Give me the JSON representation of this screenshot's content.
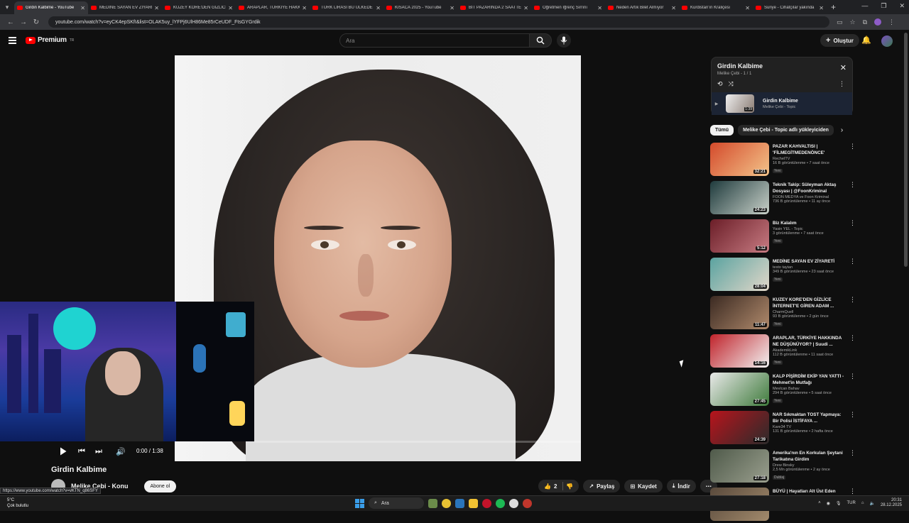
{
  "browser": {
    "tabs": [
      {
        "title": "Girdin Kalbime - YouTube",
        "active": true
      },
      {
        "title": "MEDİNE SAYAN EV ZİYARETİ",
        "active": false
      },
      {
        "title": "KUZEY KORE'DEN GİZLİCE",
        "active": false
      },
      {
        "title": "ARAPLAR, TÜRKİYE HAKKINDA",
        "active": false
      },
      {
        "title": "TÜRK LİRASI BU ÜLKEDE",
        "active": false
      },
      {
        "title": "KISACA 2025 - YouTube",
        "active": false
      },
      {
        "title": "BİT PAZARINDA 2 SAATTE",
        "active": false
      },
      {
        "title": "Öğretmen İğrenç Sırrını",
        "active": false
      },
      {
        "title": "Neden Artık Bilet Almıyor",
        "active": false
      },
      {
        "title": "Kürdistan'ın Kraliçesi",
        "active": false
      },
      {
        "title": "Suriye - Cihatçılar yakında",
        "active": false
      }
    ],
    "url": "youtube.com/watch?v=eyCK4epSKfI&list=OLAK5uy_lYFPj6UlH86Me85rCeUDF_FtsGYGrdik",
    "status_url": "https://www.youtube.com/watch?v=vKTN_q86SFY"
  },
  "youtube": {
    "logo_text": "Premium",
    "logo_region": "TR",
    "search_placeholder": "Ara",
    "create_label": "Oluştur"
  },
  "player": {
    "time": "0:00 / 1:38",
    "progress": 0.0
  },
  "video": {
    "title": "Girdin Kalbime",
    "channel": "Melike Çebi - Konu",
    "subscribe": "Abone ol",
    "likes": "2",
    "share": "Paylaş",
    "save": "Kaydet",
    "download": "İndir"
  },
  "playlist": {
    "title": "Girdin Kalbime",
    "subtitle": "Melike Çebi - 1 / 1",
    "item_title": "Girdin Kalbime",
    "item_channel": "Melike Çebi - Topic",
    "item_duration": "1:39"
  },
  "chips": [
    "Tümü",
    "Melike Çebi - Topic adlı yükleyiciden"
  ],
  "recommendations": [
    {
      "title": "PAZAR KAHVALTISI | 'FİLMEGİTMEDENÖNCE'",
      "channel": "RecheITV",
      "meta": "16 B görüntülenme • 7 saat önce",
      "badge": "Yeni",
      "duration": "32:21",
      "c1": "#d44a2b",
      "c2": "#f3c48a"
    },
    {
      "title": "Teknik Takip: Süleyman Aktaş Dosyası | @FoonKriminal",
      "channel": "FOON MEDYA ve Foon Kriminal",
      "meta": "736 B görüntülenme • 11 ay önce",
      "badge": "",
      "duration": "24:23",
      "c1": "#1f3b3d",
      "c2": "#c8d0c8"
    },
    {
      "title": "Biz Kalalım",
      "channel": "Yasin YEL - Topic",
      "meta": "3 görüntülenme • 7 saat önce",
      "badge": "Yeni",
      "duration": "5:12",
      "c1": "#6b1e28",
      "c2": "#c77b82"
    },
    {
      "title": "MEDİNE SAYAN EV ZİYARETİ",
      "channel": "testo tayian",
      "meta": "349 B görüntülenme • 23 saat önce",
      "badge": "Yeni",
      "duration": "28:04",
      "c1": "#5aa3a0",
      "c2": "#e2d7c9"
    },
    {
      "title": "KUZEY KORE'DEN GİZLİCE İNTERNET'E GİREN ADAM ...",
      "channel": "CharmQuell",
      "meta": "93 B görüntülenme • 2 gün önce",
      "badge": "Yeni",
      "duration": "11:47",
      "c1": "#3b2a22",
      "c2": "#b08a6c"
    },
    {
      "title": "ARAPLAR, TÜRKİYE HAKKINDA NE DÜŞÜNÜYOR? | Suudi ...",
      "channel": "AkademikLink",
      "meta": "112 B görüntülenme • 11 saat önce",
      "badge": "Yeni",
      "duration": "14:16",
      "c1": "#c0232b",
      "c2": "#f2f2f2"
    },
    {
      "title": "KALP PİŞİRDİM EKİP YAN YATTI - Mehmet'in Mutfağı",
      "channel": "Mevlcan Bahav",
      "meta": "294 B görüntülenme • 5 saat önce",
      "badge": "Yeni",
      "duration": "27:45",
      "c1": "#e9e9e9",
      "c2": "#3f7b3c"
    },
    {
      "title": "NAR Sıkmaktan TOST Yapmaya: Bir Polisi İSTİFAYA ...",
      "channel": "Kare34 TV",
      "meta": "131 B görüntülenme • 2 hafta önce",
      "badge": "",
      "duration": "24:39",
      "c1": "#b8141c",
      "c2": "#2b2b2b"
    },
    {
      "title": "Amerika'nın En Korkulan Şeytani Tarikatına Girdim",
      "channel": "Drew Binsky",
      "meta": "2,5 Mn görüntülenme • 2 ay önce",
      "badge": "Dublaj",
      "duration": "27:18",
      "c1": "#4f5a4a",
      "c2": "#9a9f8e"
    },
    {
      "title": "BÜYÜ | Hayatları Alt Üst Eden Gizem",
      "channel": "",
      "meta": "",
      "badge": "",
      "duration": "",
      "c1": "#5a4a3c",
      "c2": "#a28a6c"
    }
  ],
  "taskbar": {
    "weather_temp": "5°C",
    "weather_text": "Çok bulutlu",
    "search": "Ara",
    "lang": "TUR",
    "time": "20:31",
    "date": "28.12.2025"
  }
}
